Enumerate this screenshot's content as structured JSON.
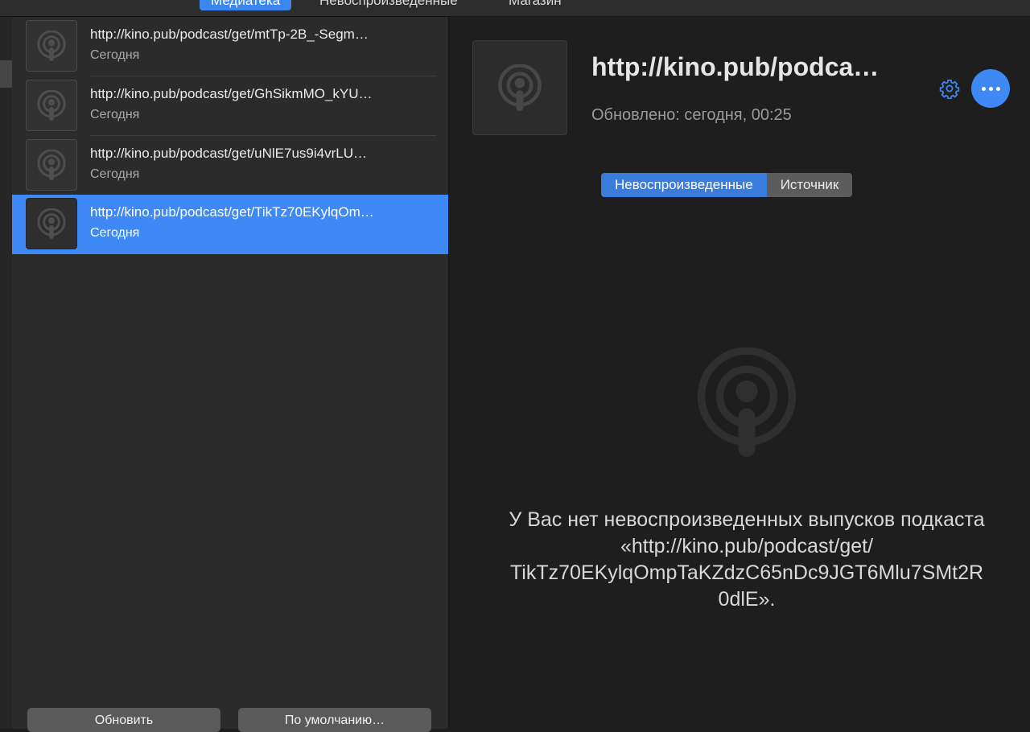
{
  "colors": {
    "accent": "#3e89f5",
    "window_bg": "#1e1e1e",
    "list_bg": "#2b2b2b"
  },
  "toolbar": {
    "tabs": [
      {
        "label": "Медиатека",
        "active": true,
        "icon": ""
      },
      {
        "label": "Невоспроизведенные",
        "active": false
      },
      {
        "label": "Магазин",
        "active": false
      }
    ]
  },
  "podcast_list": {
    "items": [
      {
        "title": "http://kino.pub/podcast/get/mtTp-2B_-Segm…",
        "date": "Сегодня",
        "icon": "podcast-icon",
        "selected": false
      },
      {
        "title": "http://kino.pub/podcast/get/GhSikmMO_kYU…",
        "date": "Сегодня",
        "icon": "podcast-icon",
        "selected": false
      },
      {
        "title": "http://kino.pub/podcast/get/uNlE7us9i4vrLU…",
        "date": "Сегодня",
        "icon": "podcast-icon",
        "selected": false
      },
      {
        "title": "http://kino.pub/podcast/get/TikTz70EKylqOm…",
        "date": "Сегодня",
        "icon": "podcast-icon",
        "selected": true
      }
    ],
    "refresh_label": "Обновить",
    "default_label": "По умолчанию…"
  },
  "detail": {
    "title": "http://kino.pub/podca…",
    "updated": "Обновлено: сегодня, 00:25",
    "settings_icon": "gear-icon",
    "more_icon": "ellipsis-icon",
    "segments": [
      {
        "label": "Невоспроизведенные",
        "active": true
      },
      {
        "label": "Источник",
        "active": false
      }
    ],
    "empty_icon": "podcast-icon",
    "empty_message_lines": [
      "У Вас нет невоспроизведенных выпусков подкаста",
      "«http://kino.pub/podcast/get/",
      "TikTz70EKylqOmpTaKZdzC65nDc9JGT6Mlu7SMt2R",
      "0dlE»."
    ]
  }
}
